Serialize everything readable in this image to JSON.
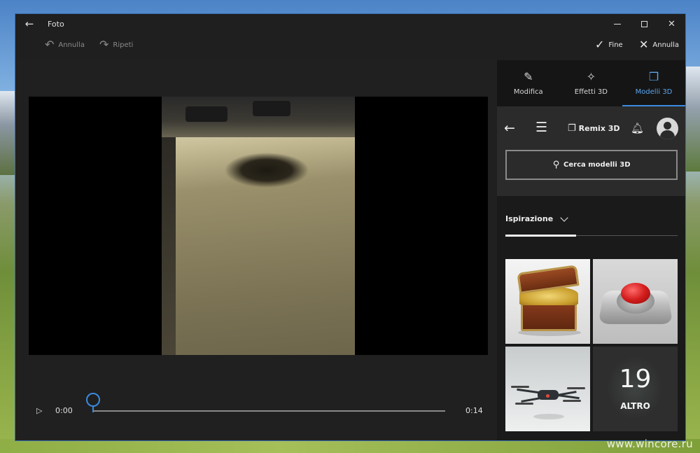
{
  "window": {
    "title": "Foto",
    "back_glyph": "←"
  },
  "toolbar": {
    "undo_label": "Annulla",
    "redo_label": "Ripeti",
    "done_label": "Fine",
    "cancel_label": "Annulla"
  },
  "player": {
    "current_time": "0:00",
    "duration": "0:14",
    "progress": 0
  },
  "panel": {
    "tabs": [
      {
        "label": "Modifica",
        "icon": "pencil-icon",
        "active": false
      },
      {
        "label": "Effetti 3D",
        "icon": "sparkle-icon",
        "active": false
      },
      {
        "label": "Modelli 3D",
        "icon": "cube-icon",
        "active": true
      }
    ],
    "remix": {
      "brand": "Remix 3D",
      "search_label": "Cerca modelli 3D"
    },
    "section": {
      "title": "Ispirazione"
    },
    "models": [
      {
        "icon": "treasure-chest-model"
      },
      {
        "icon": "red-button-model"
      },
      {
        "icon": "drone-model"
      }
    ],
    "more": {
      "count": "19",
      "label": "ALTRO"
    }
  },
  "desktop": {
    "watermark": "www.wincore.ru"
  },
  "colors": {
    "accent": "#3a8be0",
    "window_bg": "#1f1f1f",
    "panel_bg": "#1a1a1a"
  }
}
